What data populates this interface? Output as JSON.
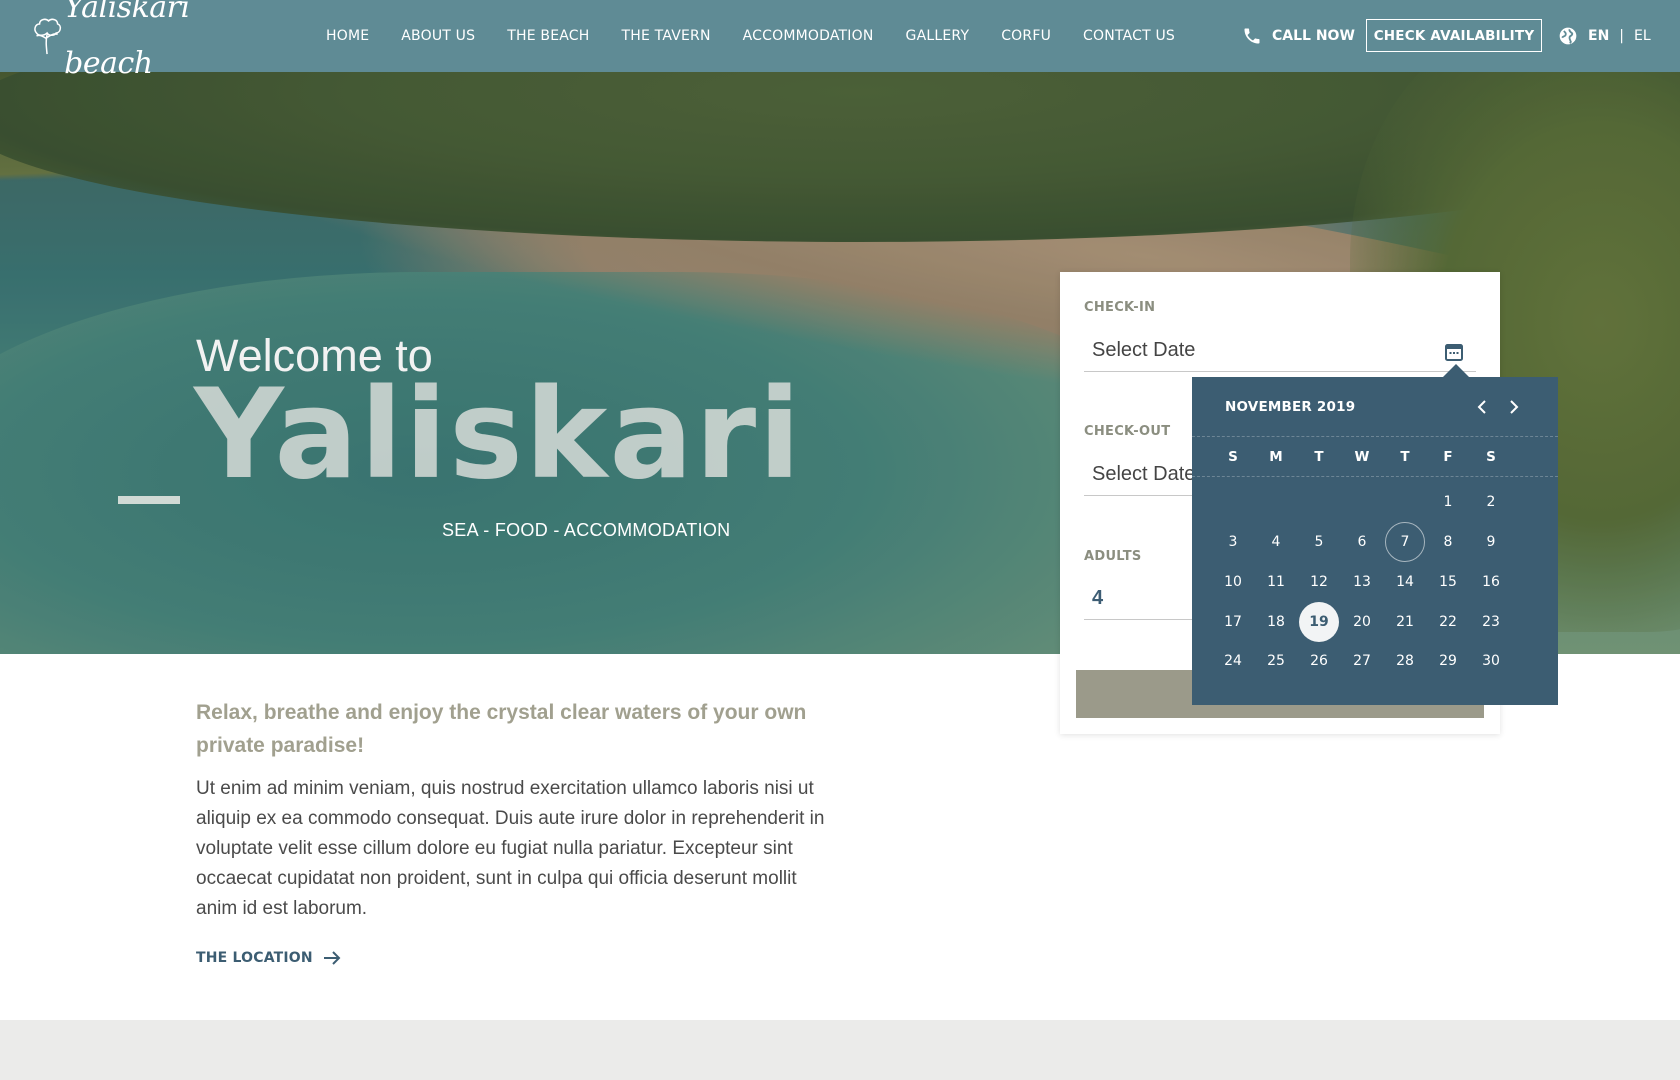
{
  "header": {
    "logo_text": "Yaliskari beach",
    "nav": [
      "HOME",
      "ABOUT US",
      "THE BEACH",
      "THE TAVERN",
      "ACCOMMODATION",
      "GALLERY",
      "CORFU",
      "CONTACT US"
    ],
    "call_label": "CALL NOW",
    "check_availability_label": "CHECK AVAILABILITY",
    "lang_active": "EN",
    "lang_separator": "|",
    "lang_other": "EL",
    "bar_color": "#5f8b95"
  },
  "hero": {
    "welcome": "Welcome to",
    "name": "Yaliskari",
    "tagline": "SEA - FOOD - ACCOMMODATION"
  },
  "booking": {
    "checkin_label": "CHECK-IN",
    "checkin_placeholder": "Select Date",
    "checkout_label": "CHECK-OUT",
    "checkout_placeholder": "Select Date",
    "adults_label": "ADULTS",
    "adults_value": "4"
  },
  "calendar": {
    "month_label": "NOVEMBER 2019",
    "weekdays": [
      "S",
      "M",
      "T",
      "W",
      "T",
      "F",
      "S"
    ],
    "first_weekday_index": 5,
    "days_in_month": 30,
    "today": 7,
    "selected": 19,
    "color": "#3c5d72"
  },
  "intro": {
    "title": "Relax, breathe and enjoy the crystal clear waters of your own private paradise!",
    "body": "Ut enim ad minim veniam, quis nostrud exercitation ullamco laboris nisi ut aliquip ex ea commodo consequat. Duis aute irure dolor in reprehenderit in voluptate velit esse cillum dolore eu fugiat nulla pariatur. Excepteur sint occaecat cupidatat non proident, sunt in culpa qui officia deserunt mollit anim id est laborum.",
    "link_label": "THE LOCATION"
  },
  "icons": {
    "phone": "phone-icon",
    "globe": "globe-icon",
    "calendar": "calendar-icon",
    "prev": "chevron-left-icon",
    "next": "chevron-right-icon",
    "arrow": "arrow-right-icon"
  }
}
